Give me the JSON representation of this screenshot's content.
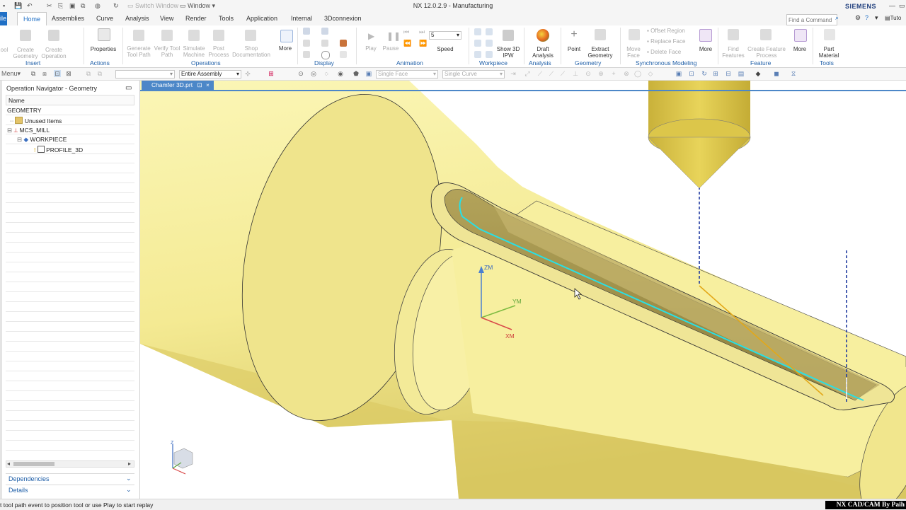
{
  "app": {
    "title": "NX 12.0.2.9 - Manufacturing",
    "brand": "SIEMENS",
    "switch_window": "Switch Window",
    "window_menu": "Window"
  },
  "menu_tabs": {
    "file": "ile",
    "items": [
      "Home",
      "Assemblies",
      "Curve",
      "Analysis",
      "View",
      "Render",
      "Tools",
      "Application",
      "Internal",
      "3Dconnexion"
    ],
    "active": "Home",
    "search_placeholder": "Find a Command",
    "tutorial": "Tuto"
  },
  "ribbon": {
    "groups": {
      "insert": "Insert",
      "actions": "Actions",
      "operations": "Operations",
      "display": "Display",
      "animation": "Animation",
      "workpiece": "Workpiece",
      "analysis": "Analysis",
      "geometry": "Geometry",
      "sync": "Synchronous Modeling",
      "feature": "Feature",
      "tools": "Tools"
    },
    "buttons": {
      "tool": "ool",
      "create_geometry": "Create Geometry",
      "create_operation": "Create Operation",
      "properties": "Properties",
      "generate_tool_path": "Generate Tool Path",
      "verify_tool_path": "Verify Tool Path",
      "simulate_machine": "Simulate Machine",
      "post_process": "Post Process",
      "shop_documentation": "Shop Documentation",
      "more_ops": "More",
      "play": "Play",
      "pause": "Pause",
      "speed_value": "5",
      "speed": "Speed",
      "show_3d_ipw": "Show 3D IPW",
      "draft_analysis": "Draft Analysis",
      "point": "Point",
      "extract_geometry": "Extract Geometry",
      "move_face": "Move Face",
      "offset_region": "Offset Region",
      "replace_face": "Replace Face",
      "delete_face": "Delete Face",
      "more_sync": "More",
      "find_features": "Find Features",
      "create_feature_process": "Create Feature Process",
      "more_feature": "More",
      "part_material": "Part Material"
    }
  },
  "toolbar": {
    "menu": "Menu",
    "filter_value": "",
    "scope": "Entire Assembly",
    "face_rule": "Single Face",
    "curve_rule": "Single Curve"
  },
  "navigator": {
    "title": "Operation Navigator - Geometry",
    "column": "Name",
    "root": "GEOMETRY",
    "items": [
      {
        "label": "Unused Items"
      },
      {
        "label": "MCS_MILL"
      },
      {
        "label": "WORKPIECE"
      },
      {
        "label": "PROFILE_3D"
      }
    ],
    "dependencies": "Dependencies",
    "details": "Details"
  },
  "document": {
    "tab": "Chamfer 3D.prt"
  },
  "viewport": {
    "axis_zm": "ZM",
    "axis_ym": "YM",
    "axis_xm": "XM",
    "triad_z": "Z"
  },
  "status": {
    "message": "t tool path event to position tool or use Play to start replay",
    "watermark": "NX CAD/CAM By Paih"
  }
}
